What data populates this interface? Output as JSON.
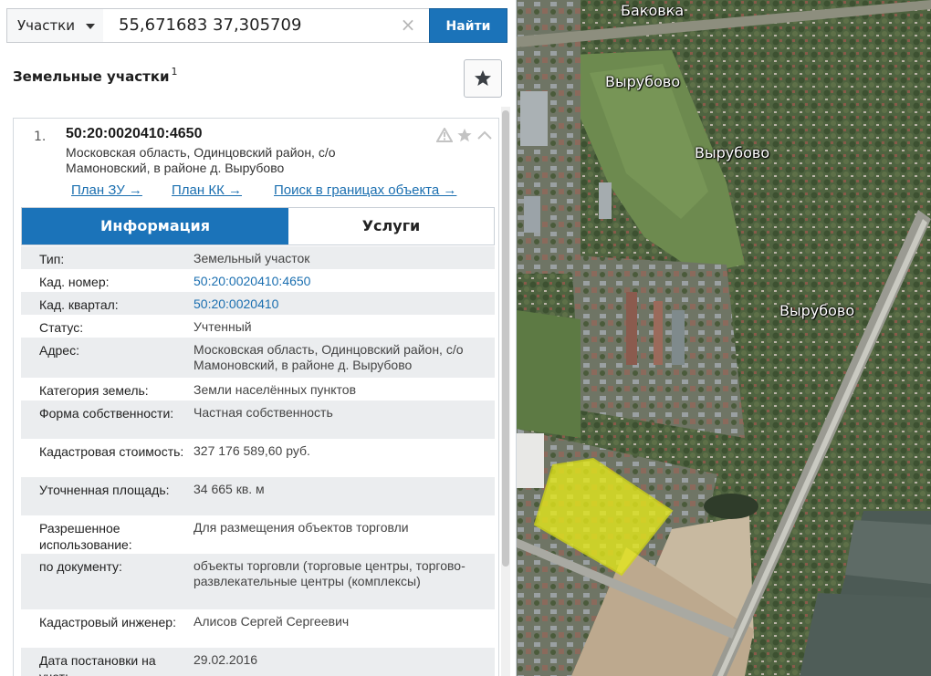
{
  "search": {
    "type_label": "Участки",
    "query": "55,671683 37,305709",
    "clear_symbol": "×",
    "find_label": "Найти"
  },
  "section": {
    "title": "Земельные участки",
    "count_sup": "1"
  },
  "item": {
    "index": "1.",
    "cad_number": "50:20:0020410:4650",
    "address_short": "Московская область, Одинцовский район, с/о Мамоновский, в районе д. Вырубово",
    "links": [
      "План ЗУ →",
      "План КК →",
      "Поиск в границах объекта →"
    ]
  },
  "tabs": {
    "info": "Информация",
    "services": "Услуги",
    "active": "Информация"
  },
  "rows": [
    {
      "label": "Тип:",
      "value": "Земельный участок"
    },
    {
      "label": "Кад. номер:",
      "value": "50:20:0020410:4650"
    },
    {
      "label": "Кад. квартал:",
      "value": "50:20:0020410"
    },
    {
      "label": "Статус:",
      "value": "Учтенный"
    },
    {
      "label": "Адрес:",
      "value": "Московская область, Одинцовский район, с/о Мамоновский, в районе д. Вырубово"
    },
    {
      "label": "Категория земель:",
      "value": "Земли населённых пунктов"
    },
    {
      "label": "Форма собственности:",
      "value": "Частная собственность"
    },
    {
      "label": "Кадастровая стоимость:",
      "value": "327 176 589,60 руб."
    },
    {
      "label": "Уточненная площадь:",
      "value": "34 665 кв. м"
    },
    {
      "label": "Разрешенное использование:",
      "value": "Для размещения объектов торговли"
    },
    {
      "label": "по документу:",
      "value": "объекты торговли (торговые центры, торгово-развлекательные центры (комплексы)"
    },
    {
      "label": "Кадастровый инженер:",
      "value": "Алисов Сергей Сергеевич"
    },
    {
      "label": "Дата постановки на учет:",
      "value": "29.02.2016"
    }
  ],
  "map": {
    "places": [
      "Баковка",
      "Вырубово",
      "Вырубово",
      "Вырубово"
    ],
    "parcel_color": "#e6ea1a"
  },
  "colors": {
    "accent": "#1b73b9",
    "link": "#1b6fb0"
  }
}
